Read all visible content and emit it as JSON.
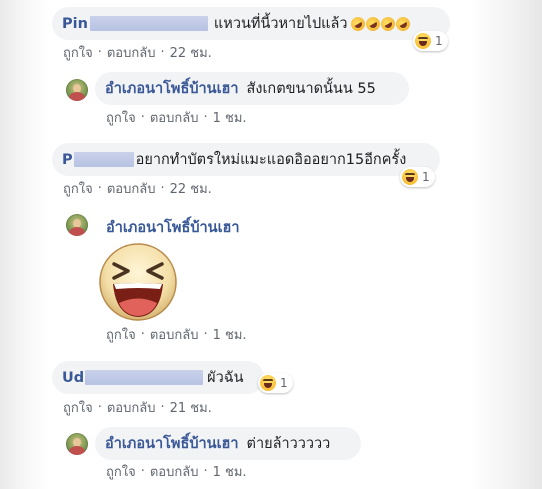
{
  "comments": [
    {
      "author_visible": "Pin",
      "text": "แหวนที่นี้วหายไปแล้ว",
      "emoji_suffix": [
        "rolling-laughing-emoji",
        "rolling-laughing-emoji",
        "rolling-laughing-emoji",
        "rolling-laughing-emoji"
      ],
      "reaction": {
        "icon": "laughing-reaction-icon",
        "count": "1"
      },
      "actions": {
        "like": "ถูกใจ",
        "reply": "ตอบกลับ",
        "time": "22 ชม."
      },
      "reply": {
        "author": "อำเภอนาโพธิ์บ้านเฮา",
        "text": "สังเกตขนาดนั้นน 55",
        "actions": {
          "like": "ถูกใจ",
          "reply": "ตอบกลับ",
          "time": "1 ชม."
        }
      }
    },
    {
      "author_visible": "P",
      "text": "อยากทำบัตรใหม่แมะแอดอิออยาก15อีกครั้ง",
      "reaction": {
        "icon": "laughing-reaction-icon",
        "count": "1"
      },
      "actions": {
        "like": "ถูกใจ",
        "reply": "ตอบกลับ",
        "time": "22 ชม."
      },
      "reply": {
        "author": "อำเภอนาโพธิ์บ้านเฮา",
        "sticker": "laughing-face-sticker",
        "actions": {
          "like": "ถูกใจ",
          "reply": "ตอบกลับ",
          "time": "1 ชม."
        }
      }
    },
    {
      "author_visible": "Ud",
      "text": "ผัวฉัน",
      "reaction": {
        "icon": "laughing-reaction-icon",
        "count": "1"
      },
      "actions": {
        "like": "ถูกใจ",
        "reply": "ตอบกลับ",
        "time": "21 ชม."
      },
      "reply": {
        "author": "อำเภอนาโพธิ์บ้านเฮา",
        "text": "ต่ายล้าววววว",
        "actions": {
          "like": "ถูกใจ",
          "reply": "ตอบกลับ",
          "time": "1 ชม."
        }
      }
    }
  ],
  "separator": "·"
}
